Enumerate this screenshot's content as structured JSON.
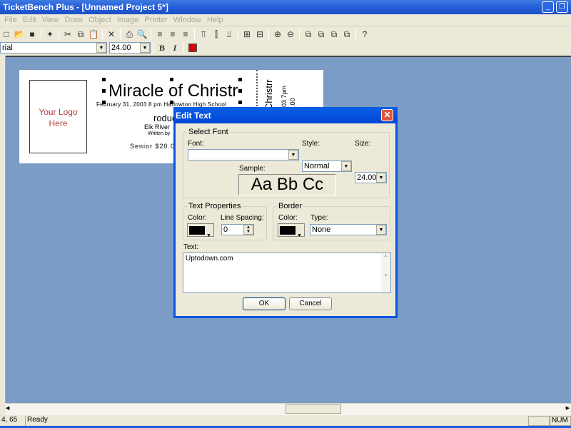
{
  "window": {
    "title": "TicketBench Plus - [Unnamed Project 5*]"
  },
  "menu": [
    "File",
    "Edit",
    "View",
    "Draw",
    "Object",
    "Image",
    "Printer",
    "Window",
    "Help"
  ],
  "toolbar": [
    {
      "icon": "new-icon",
      "g": "□"
    },
    {
      "icon": "open-icon",
      "g": "📂"
    },
    {
      "icon": "save-icon",
      "g": "■"
    },
    "|",
    {
      "icon": "wizard-icon",
      "g": "✦"
    },
    "|",
    {
      "icon": "cut-icon",
      "g": "✂"
    },
    {
      "icon": "copy-icon",
      "g": "⧉"
    },
    {
      "icon": "paste-icon",
      "g": "📋"
    },
    "|",
    {
      "icon": "delete-icon",
      "g": "✕"
    },
    "|",
    {
      "icon": "print-icon",
      "g": "⎙"
    },
    {
      "icon": "print-preview-icon",
      "g": "🔍"
    },
    "|",
    {
      "icon": "align-left-icon",
      "g": "≡"
    },
    {
      "icon": "align-center-icon",
      "g": "≡"
    },
    {
      "icon": "align-right-icon",
      "g": "≡"
    },
    "|",
    {
      "icon": "align-top-icon",
      "g": "⫪"
    },
    {
      "icon": "align-middle-icon",
      "g": "⫿"
    },
    {
      "icon": "align-bottom-icon",
      "g": "⫫"
    },
    "|",
    {
      "icon": "center-horizontal-icon",
      "g": "⊞"
    },
    {
      "icon": "center-vertical-icon",
      "g": "⊟"
    },
    "|",
    {
      "icon": "zoom-in-icon",
      "g": "⊕"
    },
    {
      "icon": "zoom-out-icon",
      "g": "⊖"
    },
    "|",
    {
      "icon": "bring-front-icon",
      "g": "⧉"
    },
    {
      "icon": "send-back-icon",
      "g": "⧉"
    },
    {
      "icon": "bring-forward-icon",
      "g": "⧉"
    },
    {
      "icon": "send-backward-icon",
      "g": "⧉"
    },
    "|",
    {
      "icon": "help-icon",
      "g": "?"
    }
  ],
  "format": {
    "font": "rial",
    "size": "24.00",
    "bold": "B",
    "italic": "I",
    "color": "#dd0000"
  },
  "ticket": {
    "logo": "Your Logo Here",
    "title": "Miracle of Christr",
    "line1": "February 31, 2003  8 pm  Harlowton High School",
    "line2": "roduc",
    "line3": "Elk River",
    "line4": "Written by",
    "line5": "Senior  $20.0",
    "stub1": "Christrr",
    "stub2": "03  7pm",
    "stub3": ".00"
  },
  "dialog": {
    "title": "Edit Text",
    "select_font": "Select Font",
    "font_label": "Font:",
    "font_value": "",
    "style_label": "Style:",
    "style_value": "Normal",
    "size_label": "Size:",
    "size_value": "24.00",
    "sample_label": "Sample:",
    "sample_text": "Aa Bb Cc",
    "text_props": "Text Properties",
    "color_label": "Color:",
    "line_spacing_label": "Line Spacing:",
    "line_spacing_value": "0",
    "border": "Border",
    "border_color_label": "Color:",
    "type_label": "Type:",
    "type_value": "None",
    "text_label": "Text:",
    "text_value": "Uptodown.com",
    "ok": "OK",
    "cancel": "Cancel",
    "text_color": "#000000",
    "border_color": "#000000"
  },
  "status": {
    "coords": "4, 65",
    "message": "Ready",
    "num": "NUM"
  }
}
